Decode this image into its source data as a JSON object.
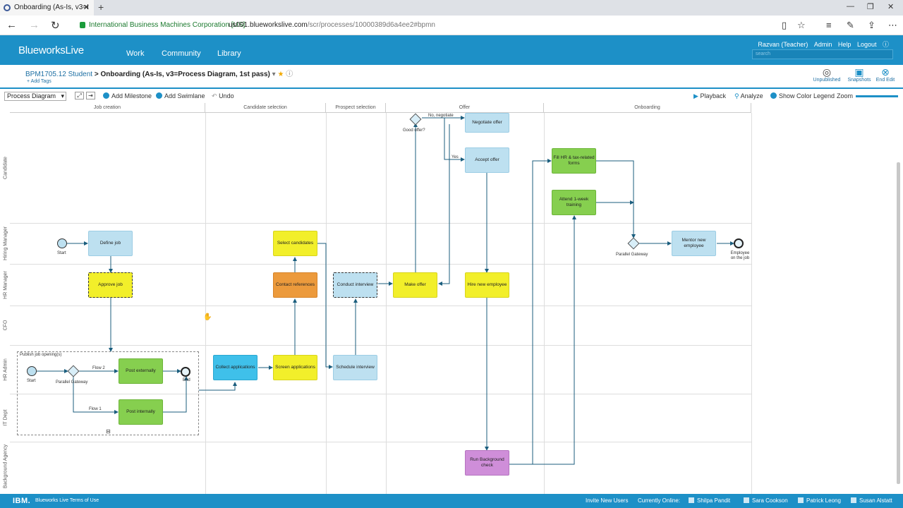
{
  "browser": {
    "tab_title": "Onboarding (As-Is, v3=I",
    "site_name": "International Business Machines Corporation [US]",
    "url_host": "us001.blueworkslive.com",
    "url_path": "/scr/processes/10000389d6a4ee2#bpmn"
  },
  "app": {
    "logo": "BlueworksLive",
    "nav": [
      "Work",
      "Community",
      "Library"
    ],
    "user": "Razvan (Teacher)",
    "user_links": [
      "Admin",
      "Help",
      "Logout"
    ],
    "search_placeholder": "search"
  },
  "process": {
    "space": "BPM1705.12 Student",
    "separator": ">",
    "title": "Onboarding (As-Is, v3=Process Diagram, 1st pass)",
    "add_tags": "+ Add Tags",
    "status_unpublished": "Unpublished",
    "snapshots": "Snapshots",
    "end_edit": "End Edit"
  },
  "toolbar": {
    "view_select": "Process Diagram",
    "add_milestone": "Add Milestone",
    "add_swimlane": "Add Swimlane",
    "undo": "Undo",
    "playback": "Playback",
    "analyze": "Analyze",
    "show_color_legend": "Show Color Legend",
    "zoom": "Zoom"
  },
  "phases": [
    "Job creation",
    "Candidate selection",
    "Prospect selection",
    "Offer",
    "Onboarding"
  ],
  "lanes": [
    "Candidate",
    "Hiring Manager",
    "HR Manager",
    "CFO",
    "HR Admin",
    "IT Dept",
    "Background Agency"
  ],
  "diagram": {
    "tasks": {
      "define_job": "Define job",
      "approve_job": "Approve job",
      "post_externally": "Post externally",
      "post_internally": "Post internally",
      "collect_applications": "Collect applications",
      "screen_applications": "Screen applications",
      "select_candidates": "Select candidates",
      "contact_references": "Contact references",
      "conduct_interview": "Conduct interview",
      "schedule_interview": "Schedule interview",
      "make_offer": "Make offer",
      "negotiate_offer": "Negotiate offer",
      "accept_offer": "Accept offer",
      "hire_new_employee": "Hire new employee",
      "run_background_check": "Run Background check",
      "fill_hr_forms": "Fill HR & tax-related forms",
      "attend_training": "Attend 1-week training",
      "mentor_new_employee": "Mentor new employee"
    },
    "labels": {
      "start": "Start",
      "start2": "Start",
      "end": "End",
      "parallel_gateway": "Parallel Gateway",
      "parallel_gateway2": "Parallel Gateway",
      "flow2": "Flow 2",
      "flow1": "Flow 1",
      "subprocess": "Publish job opening(s)",
      "good_offer": "Good offer?",
      "no_negotiate": "No, negotiate",
      "yes": "Yes",
      "employee_on_job": "Employee on the job"
    }
  },
  "footer": {
    "ibm": "IBM.",
    "terms": "Blueworks Live Terms of Use",
    "invite": "Invite New Users",
    "online_label": "Currently Online:",
    "online_users": [
      "Shilpa Pandit",
      "Sara Cookson",
      "Patrick Leong",
      "Susan Alstatt"
    ]
  },
  "colors": {
    "brand_blue": "#1d90c7",
    "task_blue": "#bde0f0",
    "task_yellow": "#f2ef2a",
    "task_green": "#86cf4f",
    "task_orange": "#ec9a3c",
    "task_purple": "#cf8ed9"
  }
}
